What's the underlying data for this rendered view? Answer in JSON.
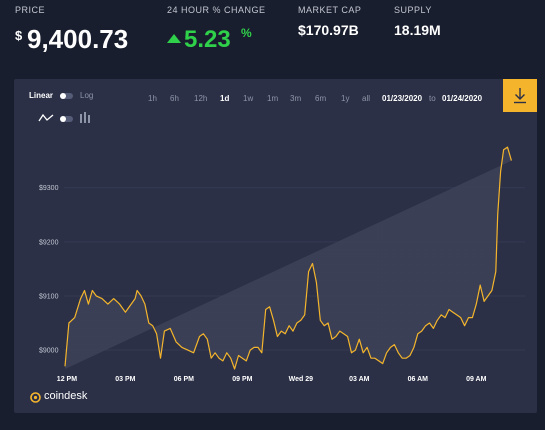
{
  "stats": {
    "price_label": "PRICE",
    "price_currency": "$",
    "price_value": "9,400.73",
    "change_label": "24 HOUR % CHANGE",
    "change_value": "5.23",
    "change_unit": "%",
    "mcap_label": "MARKET CAP",
    "mcap_value": "$170.97B",
    "supply_label": "SUPPLY",
    "supply_value": "18.19M"
  },
  "colors": {
    "positive": "#2fd04a",
    "line": "#f4b52c",
    "panel": "#2b3047",
    "background": "#191e2e"
  },
  "controls": {
    "scale_linear": "Linear",
    "scale_log": "Log",
    "ranges": [
      "1h",
      "6h",
      "12h",
      "1d",
      "1w",
      "1m",
      "3m",
      "6m",
      "1y",
      "all"
    ],
    "active_range": "1d",
    "date_from": "01/23/2020",
    "date_sep": "to",
    "date_to": "01/24/2020",
    "icons": {
      "line_type": "line-chart-icon",
      "bar_type": "bar-chart-icon",
      "download": "download-icon"
    }
  },
  "brand": {
    "name": "coindesk",
    "icon": "coindesk-logo-icon"
  },
  "chart_data": {
    "type": "area",
    "title": "",
    "xlabel": "",
    "ylabel": "",
    "x_tick_labels": [
      "12 PM",
      "03 PM",
      "06 PM",
      "09 PM",
      "Wed 29",
      "03 AM",
      "06 AM",
      "09 AM"
    ],
    "y_ticks": [
      9000,
      9100,
      9200,
      9300
    ],
    "y_tick_labels": [
      "$9000",
      "$9100",
      "$9200",
      "$9300"
    ],
    "ylim": [
      8965,
      9390
    ],
    "x_hours_range": [
      -0.15,
      23.5
    ],
    "x": [
      -0.1,
      0.1,
      0.4,
      0.7,
      0.9,
      1.1,
      1.3,
      1.5,
      1.8,
      2.1,
      2.4,
      2.7,
      3.0,
      3.3,
      3.5,
      3.6,
      3.8,
      4.0,
      4.2,
      4.4,
      4.6,
      4.8,
      5.0,
      5.3,
      5.6,
      5.9,
      6.2,
      6.5,
      6.8,
      7.0,
      7.2,
      7.4,
      7.6,
      7.8,
      8.0,
      8.2,
      8.4,
      8.6,
      8.8,
      9.0,
      9.2,
      9.4,
      9.6,
      9.8,
      10.0,
      10.2,
      10.4,
      10.6,
      10.8,
      11.0,
      11.2,
      11.4,
      11.6,
      11.8,
      12.0,
      12.2,
      12.4,
      12.6,
      12.8,
      13.0,
      13.2,
      13.4,
      13.6,
      13.8,
      14.0,
      14.2,
      14.4,
      14.6,
      14.8,
      15.0,
      15.2,
      15.4,
      15.6,
      15.8,
      16.0,
      16.2,
      16.4,
      16.6,
      16.8,
      17.0,
      17.2,
      17.4,
      17.6,
      17.8,
      18.0,
      18.2,
      18.4,
      18.6,
      18.8,
      19.0,
      19.2,
      19.4,
      19.6,
      19.8,
      20.0,
      20.2,
      20.4,
      20.6,
      20.8,
      21.0,
      21.2,
      21.4,
      21.6,
      21.8,
      22.0,
      22.1,
      22.25,
      22.4,
      22.6,
      22.8,
      23.0,
      23.2,
      23.4
    ],
    "series": [
      {
        "values": [
          8970,
          9050,
          9060,
          9095,
          9110,
          9085,
          9110,
          9100,
          9095,
          9085,
          9095,
          9085,
          9070,
          9085,
          9095,
          9110,
          9100,
          9085,
          9050,
          9045,
          9030,
          8985,
          9035,
          9040,
          9015,
          9005,
          9000,
          8995,
          9025,
          9030,
          9020,
          8985,
          8995,
          8985,
          8980,
          8995,
          8985,
          8965,
          8990,
          8985,
          8980,
          9000,
          9005,
          9005,
          8995,
          9075,
          9080,
          9055,
          9025,
          9035,
          9030,
          9045,
          9035,
          9050,
          9055,
          9065,
          9145,
          9160,
          9125,
          9055,
          9045,
          9050,
          9020,
          9025,
          9035,
          9030,
          9025,
          8995,
          9000,
          9020,
          8995,
          9005,
          8985,
          8985,
          8980,
          8975,
          8995,
          9005,
          9010,
          8995,
          8985,
          8985,
          8990,
          9005,
          9030,
          9035,
          9045,
          9050,
          9040,
          9055,
          9065,
          9060,
          9075,
          9070,
          9065,
          9060,
          9045,
          9060,
          9060,
          9085,
          9120,
          9090,
          9100,
          9110,
          9145,
          9250,
          9330,
          9370,
          9375,
          9350
        ]
      }
    ],
    "grid": true,
    "legend": "none"
  }
}
